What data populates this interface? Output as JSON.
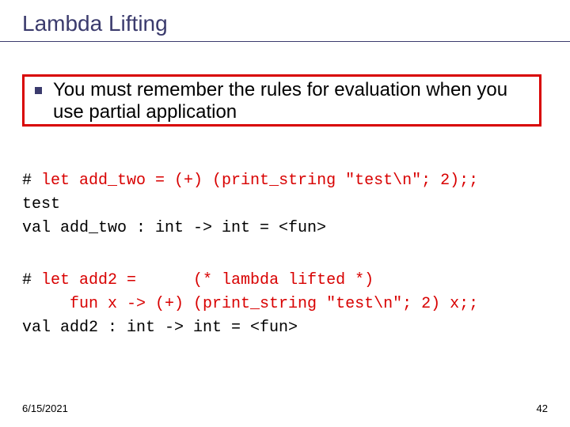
{
  "title": "Lambda Lifting",
  "bullet": "You must remember the rules for evaluation when you use partial application",
  "code1": {
    "l1a": "# ",
    "l1b": "let add_two = (+) (print_string \"test\\n\"; 2);;",
    "l2": "test",
    "l3": "val add_two : int -> int = <fun>"
  },
  "code2": {
    "l1a": "# ",
    "l1b": "let add2 =      (* lambda lifted *)",
    "l2": "     fun x -> (+) (print_string \"test\\n\"; 2) x;;",
    "l3": "val add2 : int -> int = <fun>"
  },
  "footer": {
    "date": "6/15/2021",
    "page": "42"
  }
}
